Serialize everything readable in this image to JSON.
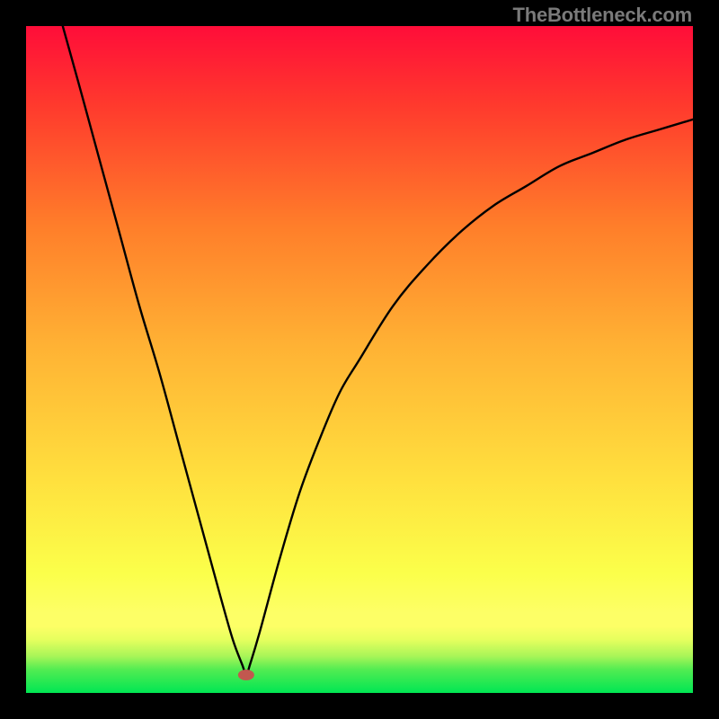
{
  "caption": "TheBottleneck.com",
  "chart_data": {
    "type": "line",
    "title": "",
    "xlabel": "",
    "ylabel": "",
    "xlim": [
      0,
      100
    ],
    "ylim": [
      0,
      100
    ],
    "grid": false,
    "legend": false,
    "background_gradient": {
      "top_color": "#ff0d39",
      "mid_color": "#ffd53a",
      "bottom_green_color": "#00e653",
      "green_band_start_y": 96.5,
      "yellow_band_start_y": 90
    },
    "curve_minimum": {
      "x": 33,
      "y": 97.5
    },
    "curve_marker": {
      "x": 33,
      "y": 97.3,
      "color": "#c1584f"
    },
    "series": [
      {
        "name": "bottleneck-curve",
        "x": [
          5.5,
          8,
          11,
          14,
          17,
          20,
          23,
          26,
          29,
          31,
          32.5,
          33,
          33.5,
          35,
          38,
          41,
          44,
          47,
          50,
          55,
          60,
          65,
          70,
          75,
          80,
          85,
          90,
          95,
          100
        ],
        "y": [
          0,
          9,
          20,
          31,
          42,
          52,
          63,
          74,
          85,
          92,
          96,
          97.5,
          96,
          91,
          80,
          70,
          62,
          55,
          50,
          42,
          36,
          31,
          27,
          24,
          21,
          19,
          17,
          15.5,
          14
        ]
      }
    ]
  }
}
